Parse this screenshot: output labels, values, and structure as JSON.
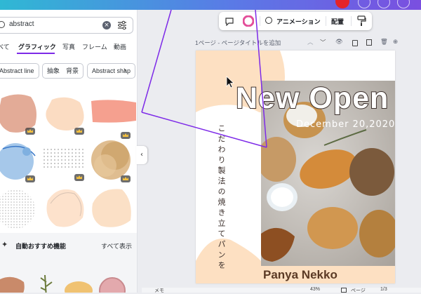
{
  "search": {
    "query": "abstract"
  },
  "tabs": [
    "べて",
    "グラフィック",
    "写真",
    "フレーム",
    "動画"
  ],
  "tabs_active": "グラフィック",
  "chips": [
    "Abstract line",
    "抽象　背景",
    "Abstract shap"
  ],
  "recommend": {
    "title": "自動おすすめ機能",
    "see_all": "すべて表示"
  },
  "toolbar": {
    "animation": "アニメーション",
    "position": "配置"
  },
  "pagebar": {
    "label": "1ページ - ページタイトルを追加"
  },
  "design": {
    "headline": "New Open",
    "date": "December 20,2020",
    "vertical": "こだわり製法の焼き立てパンを",
    "brand": "Panya Nekko"
  },
  "bottom": {
    "notes": "メモ",
    "zoom": "43%",
    "pages": "ページ",
    "page_count": "1/3"
  },
  "colors": {
    "accent": "#7d2ae8",
    "peach": "#fde0c2",
    "brown": "#5b3a25"
  }
}
